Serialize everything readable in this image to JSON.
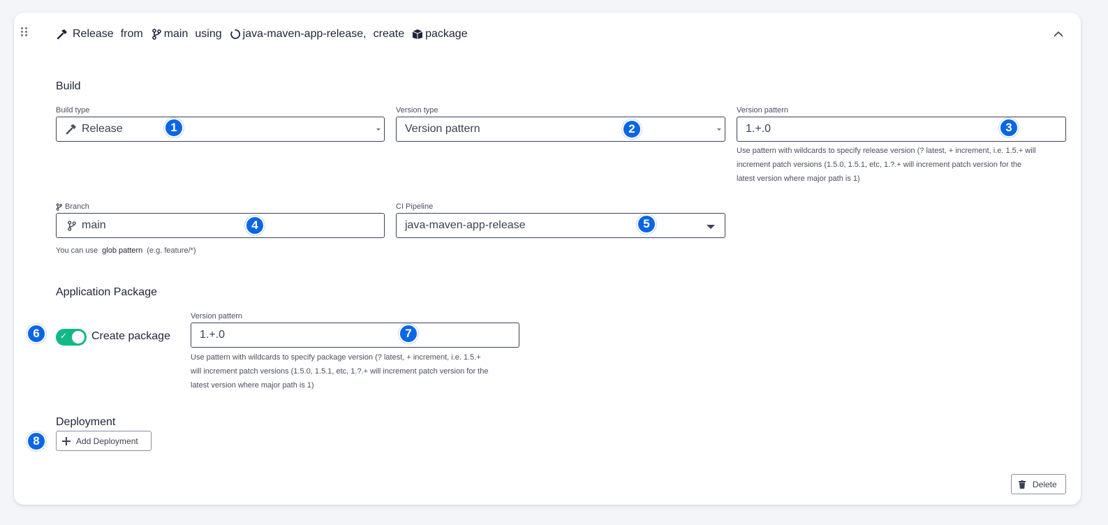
{
  "header": {
    "build_type": "Release",
    "from": "from",
    "branch": "main",
    "using": "using",
    "pipeline": "java-maven-app-release,",
    "create": "create",
    "package": "package"
  },
  "build": {
    "section_title": "Build",
    "build_type_label": "Build type",
    "build_type_value": "Release",
    "version_type_label": "Version type",
    "version_type_value": "Version pattern",
    "version_pattern_label": "Version pattern",
    "version_pattern_value": "1.+.0",
    "version_pattern_help_1": "Use pattern with wildcards to specify release version (? latest, + increment, i.e. 1.5.+ will",
    "version_pattern_help_2": "increment patch versions (1.5.0, 1.5.1, etc, 1.?.+ will increment patch version for the",
    "version_pattern_help_3": "latest version where major path is 1)",
    "branch_label": "Branch",
    "branch_value": "main",
    "branch_help_prefix": "You can use",
    "branch_help_link": "glob pattern",
    "branch_help_suffix": "(e.g. feature/*)",
    "ci_pipeline_label": "CI Pipeline",
    "ci_pipeline_value": "java-maven-app-release"
  },
  "package": {
    "section_title": "Application Package",
    "toggle_label": "Create package",
    "toggle_on": true,
    "version_pattern_label": "Version pattern",
    "version_pattern_value": "1.+.0",
    "help_1": "Use pattern with wildcards to specify package version (? latest, + increment, i.e. 1.5.+",
    "help_2": "will increment patch versions (1.5.0, 1.5.1, etc, 1.?.+ will increment patch version for the",
    "help_3": "latest version where major path is 1)"
  },
  "deployment": {
    "section_title": "Deployment",
    "add_button": "Add Deployment"
  },
  "footer": {
    "delete_button": "Delete"
  },
  "badges": [
    "1",
    "2",
    "3",
    "4",
    "5",
    "6",
    "7",
    "8"
  ],
  "colors": {
    "accent_badge": "#0a66e4",
    "toggle_on": "#12b886",
    "input_border": "#3d4258"
  },
  "icons": {
    "build_type": "hammer-icon",
    "branch": "git-branch-icon",
    "pipeline": "pipeline-circle-icon",
    "package": "box-icon",
    "collapse": "chevron-up-icon",
    "add": "plus-icon",
    "delete": "trash-icon",
    "drag": "drag-handle-icon"
  }
}
